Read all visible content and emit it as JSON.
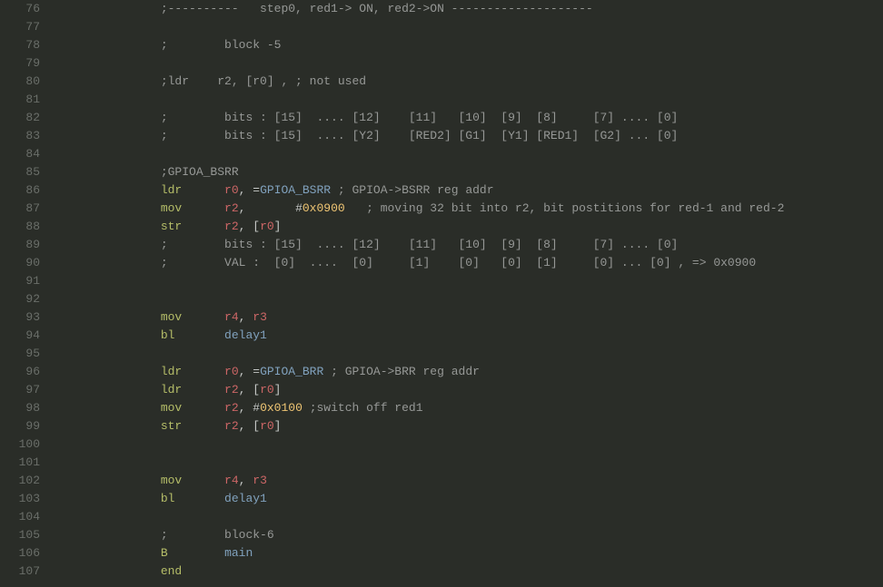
{
  "first_line": 76,
  "indent": "                ",
  "lines": [
    {
      "t": "comment",
      "text": ";----------   step0, red1-> ON, red2->ON --------------------"
    },
    {
      "t": "blank"
    },
    {
      "t": "comment",
      "text": ";        block -5"
    },
    {
      "t": "blank"
    },
    {
      "t": "comment",
      "text": ";ldr    r2, [r0] , ; not used"
    },
    {
      "t": "blank"
    },
    {
      "t": "comment",
      "text": ";        bits : [15]  .... [12]    [11]   [10]  [9]  [8]     [7] .... [0]"
    },
    {
      "t": "comment",
      "text": ";        bits : [15]  .... [Y2]    [RED2] [G1]  [Y1] [RED1]  [G2] ... [0]"
    },
    {
      "t": "blank"
    },
    {
      "t": "comment",
      "text": ";GPIOA_BSRR"
    },
    {
      "t": "instr",
      "op": "ldr",
      "args": [
        {
          "k": "reg",
          "v": "r0"
        },
        {
          "k": "punct",
          "v": ", ="
        },
        {
          "k": "label",
          "v": "GPIOA_BSRR"
        },
        {
          "k": "space",
          "v": " "
        },
        {
          "k": "comment",
          "v": "; GPIOA->BSRR reg addr"
        }
      ]
    },
    {
      "t": "instr",
      "op": "mov",
      "args": [
        {
          "k": "reg",
          "v": "r2"
        },
        {
          "k": "punct",
          "v": ",       #"
        },
        {
          "k": "number",
          "v": "0x0900"
        },
        {
          "k": "space",
          "v": "   "
        },
        {
          "k": "comment",
          "v": "; moving 32 bit into r2, bit postitions for red-1 and red-2"
        }
      ]
    },
    {
      "t": "instr",
      "op": "str",
      "args": [
        {
          "k": "reg",
          "v": "r2"
        },
        {
          "k": "punct",
          "v": ", ["
        },
        {
          "k": "reg",
          "v": "r0"
        },
        {
          "k": "punct",
          "v": "]"
        }
      ]
    },
    {
      "t": "comment",
      "text": ";        bits : [15]  .... [12]    [11]   [10]  [9]  [8]     [7] .... [0]"
    },
    {
      "t": "comment",
      "text": ";        VAL :  [0]  ....  [0]     [1]    [0]   [0]  [1]     [0] ... [0] , => 0x0900"
    },
    {
      "t": "blank"
    },
    {
      "t": "blank"
    },
    {
      "t": "instr",
      "op": "mov",
      "args": [
        {
          "k": "reg",
          "v": "r4"
        },
        {
          "k": "punct",
          "v": ", "
        },
        {
          "k": "reg",
          "v": "r3"
        }
      ]
    },
    {
      "t": "instr",
      "op": "bl",
      "args": [
        {
          "k": "label",
          "v": "delay1"
        }
      ]
    },
    {
      "t": "blank"
    },
    {
      "t": "instr",
      "op": "ldr",
      "args": [
        {
          "k": "reg",
          "v": "r0"
        },
        {
          "k": "punct",
          "v": ", ="
        },
        {
          "k": "label",
          "v": "GPIOA_BRR"
        },
        {
          "k": "space",
          "v": " "
        },
        {
          "k": "comment",
          "v": "; GPIOA->BRR reg addr"
        }
      ]
    },
    {
      "t": "instr",
      "op": "ldr",
      "args": [
        {
          "k": "reg",
          "v": "r2"
        },
        {
          "k": "punct",
          "v": ", ["
        },
        {
          "k": "reg",
          "v": "r0"
        },
        {
          "k": "punct",
          "v": "]"
        }
      ]
    },
    {
      "t": "instr",
      "op": "mov",
      "args": [
        {
          "k": "reg",
          "v": "r2"
        },
        {
          "k": "punct",
          "v": ", #"
        },
        {
          "k": "number",
          "v": "0x0100"
        },
        {
          "k": "space",
          "v": " "
        },
        {
          "k": "comment",
          "v": ";switch off red1"
        }
      ]
    },
    {
      "t": "instr",
      "op": "str",
      "args": [
        {
          "k": "reg",
          "v": "r2"
        },
        {
          "k": "punct",
          "v": ", ["
        },
        {
          "k": "reg",
          "v": "r0"
        },
        {
          "k": "punct",
          "v": "]"
        }
      ]
    },
    {
      "t": "blank"
    },
    {
      "t": "blank"
    },
    {
      "t": "instr",
      "op": "mov",
      "args": [
        {
          "k": "reg",
          "v": "r4"
        },
        {
          "k": "punct",
          "v": ", "
        },
        {
          "k": "reg",
          "v": "r3"
        }
      ]
    },
    {
      "t": "instr",
      "op": "bl",
      "args": [
        {
          "k": "label",
          "v": "delay1"
        }
      ]
    },
    {
      "t": "blank"
    },
    {
      "t": "comment",
      "text": ";        block-6"
    },
    {
      "t": "instr",
      "op": "B",
      "args": [
        {
          "k": "label",
          "v": "main"
        }
      ]
    },
    {
      "t": "instr",
      "op": "end",
      "args": []
    }
  ],
  "mnemonic_col_width": 9
}
